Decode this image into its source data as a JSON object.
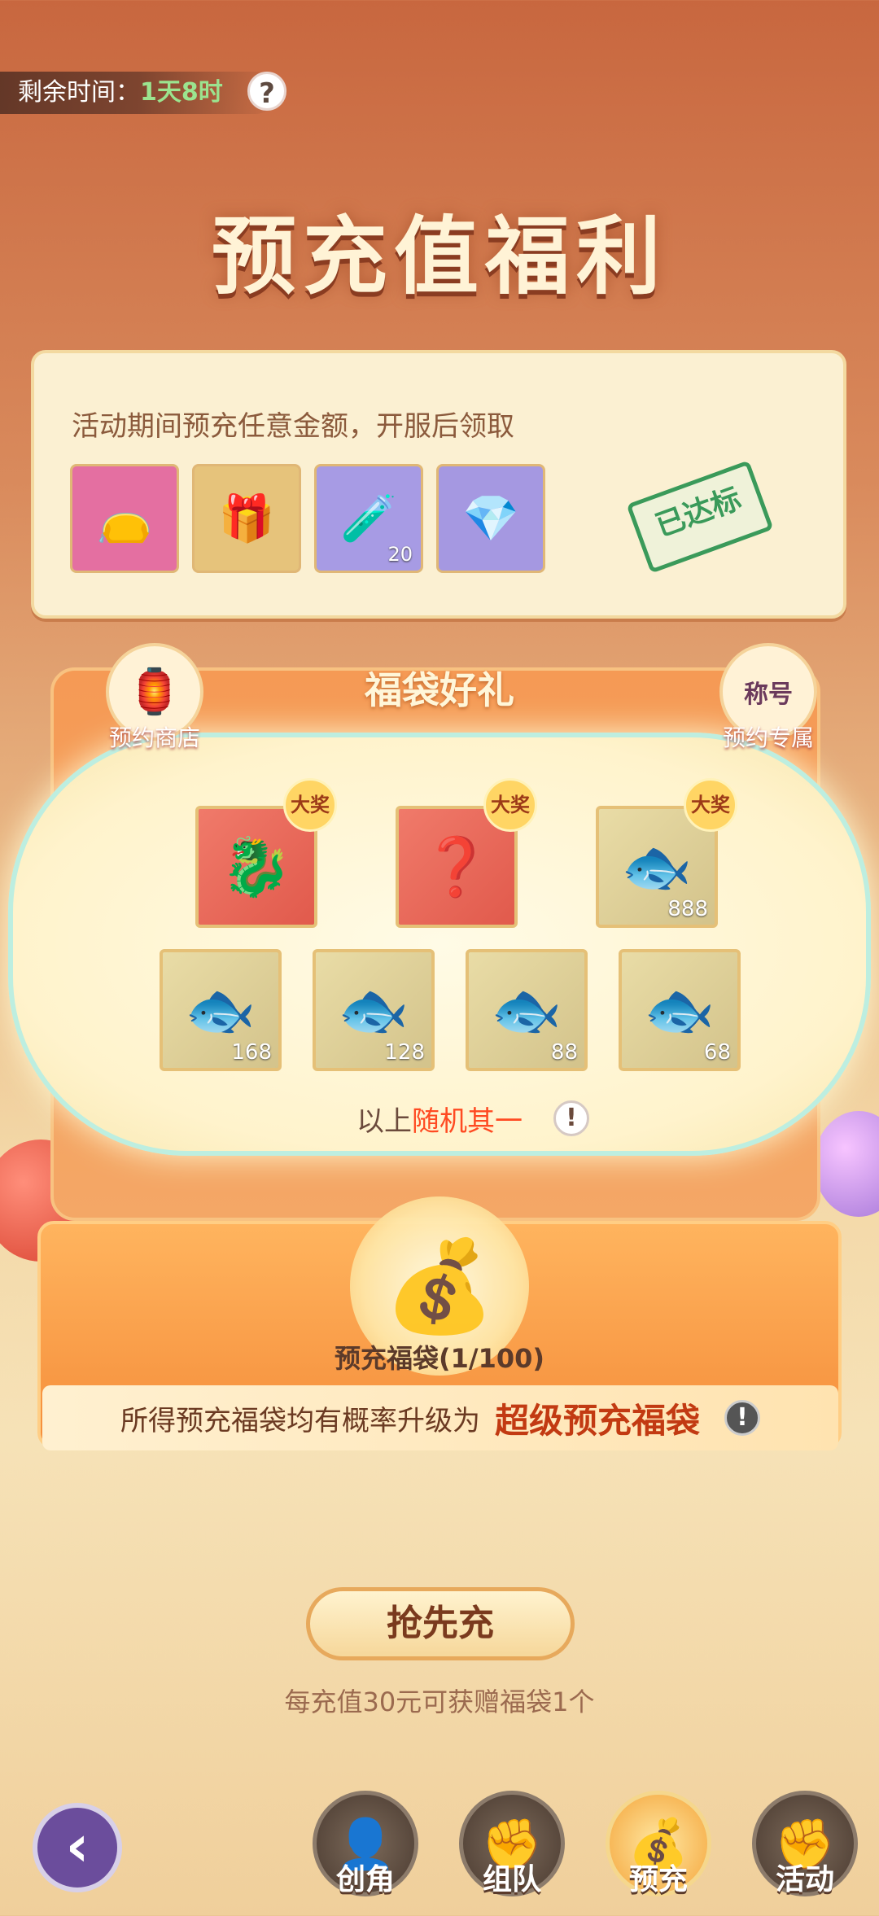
{
  "header": {
    "timer_label": "剩余时间：",
    "timer_value": "1天8时",
    "help_glyph": "?",
    "title": "预充值福利"
  },
  "panel": {
    "description": "活动期间预充任意金额，开服后领取",
    "items": [
      {
        "icon": "purple-pouch-icon",
        "glyph": "👝",
        "qty": "",
        "bg": "#e46fa1"
      },
      {
        "icon": "gift-box-icon",
        "glyph": "🎁",
        "qty": "",
        "bg": "#e6c37b"
      },
      {
        "icon": "potion-bottle-icon",
        "glyph": "🧪",
        "qty": "20",
        "bg": "#a79be4"
      },
      {
        "icon": "treasure-chest-icon",
        "glyph": "💎",
        "qty": "",
        "bg": "#a598e1"
      }
    ],
    "status_stamp": "已达标"
  },
  "gift": {
    "title": "福袋好礼",
    "left_label": "预约商店",
    "right_label": "预约专属",
    "right_icon_text": "称号",
    "top_prizes": [
      {
        "icon": "dragon-mount-icon",
        "glyph": "🐉",
        "qty": "",
        "badge": "大奖",
        "red": true
      },
      {
        "icon": "mystery-orb-icon",
        "glyph": "❓",
        "qty": "",
        "badge": "大奖",
        "red": true
      },
      {
        "icon": "jade-amulet-icon",
        "glyph": "🐟",
        "qty": "888",
        "badge": "大奖",
        "red": false
      }
    ],
    "bottom_prizes": [
      {
        "icon": "jade-amulet-icon",
        "glyph": "🐟",
        "qty": "168"
      },
      {
        "icon": "jade-amulet-icon",
        "glyph": "🐟",
        "qty": "128"
      },
      {
        "icon": "jade-amulet-icon",
        "glyph": "🐟",
        "qty": "88"
      },
      {
        "icon": "jade-amulet-icon",
        "glyph": "🐟",
        "qty": "68"
      }
    ],
    "random_prefix": "以上",
    "random_highlight": "随机其一"
  },
  "bag": {
    "label": "预充福袋(1/100)",
    "banner_text": "所得预充福袋均有概率升级为",
    "banner_highlight": "超级预充福袋"
  },
  "cta": {
    "button": "抢先充",
    "subtitle": "每充值30元可获赠福袋1个"
  },
  "nav": {
    "items": [
      {
        "label": "创角",
        "icon": "character-icon",
        "glyph": "👤",
        "active": false
      },
      {
        "label": "组队",
        "icon": "team-icon",
        "glyph": "✊",
        "active": false
      },
      {
        "label": "预充",
        "icon": "lucky-bag-icon",
        "glyph": "💰",
        "active": true
      },
      {
        "label": "活动",
        "icon": "event-icon",
        "glyph": "✊",
        "active": false
      }
    ]
  }
}
